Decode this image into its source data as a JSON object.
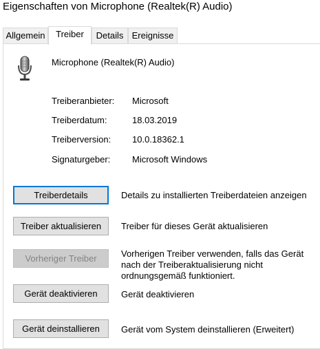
{
  "window": {
    "title": "Eigenschaften von Microphone (Realtek(R) Audio)"
  },
  "tabs": [
    {
      "label": "Allgemein",
      "active": false
    },
    {
      "label": "Treiber",
      "active": true
    },
    {
      "label": "Details",
      "active": false
    },
    {
      "label": "Ereignisse",
      "active": false
    }
  ],
  "device": {
    "name": "Microphone (Realtek(R) Audio)",
    "icon": "microphone-icon"
  },
  "info": [
    {
      "label": "Treiberanbieter:",
      "value": "Microsoft"
    },
    {
      "label": "Treiberdatum:",
      "value": "18.03.2019"
    },
    {
      "label": "Treiberversion:",
      "value": "10.0.18362.1"
    },
    {
      "label": "Signaturgeber:",
      "value": "Microsoft Windows"
    }
  ],
  "actions": [
    {
      "button": "Treiberdetails",
      "description": "Details zu installierten Treiberdateien anzeigen",
      "enabled": true
    },
    {
      "button": "Treiber aktualisieren",
      "description": "Treiber für dieses Gerät aktualisieren",
      "enabled": true
    },
    {
      "button": "Vorheriger Treiber",
      "description": "Vorherigen Treiber verwenden, falls das Gerät nach der Treiberaktualisierung nicht ordnungsgemäß funktioniert.",
      "enabled": false
    },
    {
      "button": "Gerät deaktivieren",
      "description": "Gerät deaktivieren",
      "enabled": true
    },
    {
      "button": "Gerät deinstallieren",
      "description": "Gerät vom System deinstallieren (Erweitert)",
      "enabled": true
    }
  ],
  "colors": {
    "focus_border": "#0078d7",
    "button_face": "#e1e1e1",
    "disabled_face": "#cccccc",
    "disabled_text": "#838383"
  }
}
